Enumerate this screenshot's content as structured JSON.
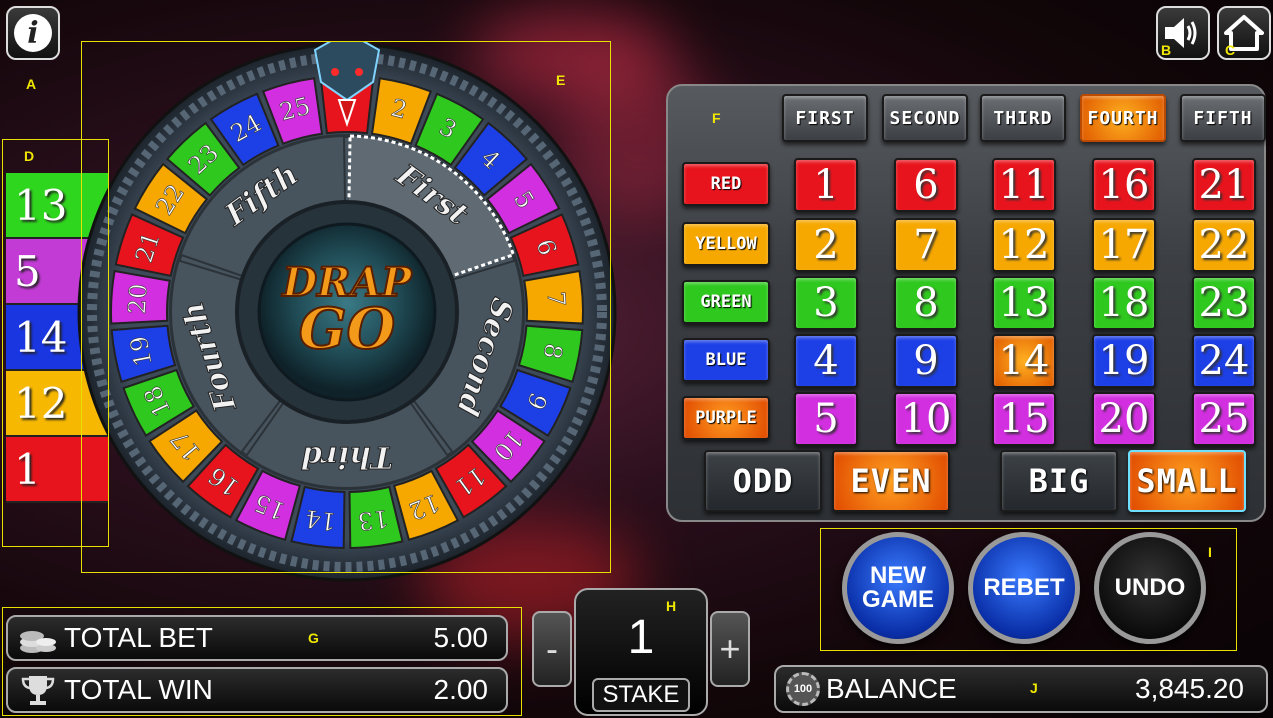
{
  "top_buttons": {
    "info": "i"
  },
  "annotations": [
    "A",
    "B",
    "C",
    "D",
    "E",
    "F",
    "G",
    "H",
    "I",
    "J"
  ],
  "history": [
    {
      "value": "13",
      "color": "#2fd61e"
    },
    {
      "value": "5",
      "color": "#c13bd4"
    },
    {
      "value": "14",
      "color": "#1a36e0"
    },
    {
      "value": "12",
      "color": "#f6b800"
    },
    {
      "value": "1",
      "color": "#e8141d"
    }
  ],
  "wheel": {
    "numbers": [
      "1",
      "2",
      "3",
      "4",
      "5",
      "6",
      "7",
      "8",
      "9",
      "10",
      "11",
      "12",
      "13",
      "14",
      "15",
      "16",
      "17",
      "18",
      "19",
      "20",
      "21",
      "22",
      "23",
      "24",
      "25"
    ],
    "sections": [
      "First",
      "Second",
      "Third",
      "Fourth",
      "Fifth"
    ],
    "logo_line1": "DRAP",
    "logo_line2": "GO"
  },
  "colors": {
    "red": "#e8141d",
    "yellow": "#f6a800",
    "green": "#2fc81e",
    "blue": "#1d3fe6",
    "purple": "#d22fe0",
    "orange": "#f07a10"
  },
  "board": {
    "headers": [
      "FIRST",
      "SECOND",
      "THIRD",
      "FOURTH",
      "FIFTH"
    ],
    "selected_header": 3,
    "color_bets": [
      "RED",
      "YELLOW",
      "GREEN",
      "BLUE",
      "PURPLE"
    ],
    "rows": [
      [
        "1",
        "6",
        "11",
        "16",
        "21"
      ],
      [
        "2",
        "7",
        "12",
        "17",
        "22"
      ],
      [
        "3",
        "8",
        "13",
        "18",
        "23"
      ],
      [
        "4",
        "9",
        "14",
        "19",
        "24"
      ],
      [
        "5",
        "10",
        "15",
        "20",
        "25"
      ]
    ],
    "odd": "ODD",
    "even": "EVEN",
    "big": "BIG",
    "small": "SMALL"
  },
  "actions": {
    "new_game_1": "NEW",
    "new_game_2": "GAME",
    "rebet": "REBET",
    "undo": "UNDO"
  },
  "totals": {
    "total_bet_label": "TOTAL BET",
    "total_bet": "5.00",
    "total_win_label": "TOTAL WIN",
    "total_win": "2.00"
  },
  "stake": {
    "minus": "-",
    "value": "1",
    "plus": "+",
    "label": "STAKE"
  },
  "balance": {
    "chip": "100",
    "label": "BALANCE",
    "value": "3,845.20"
  }
}
